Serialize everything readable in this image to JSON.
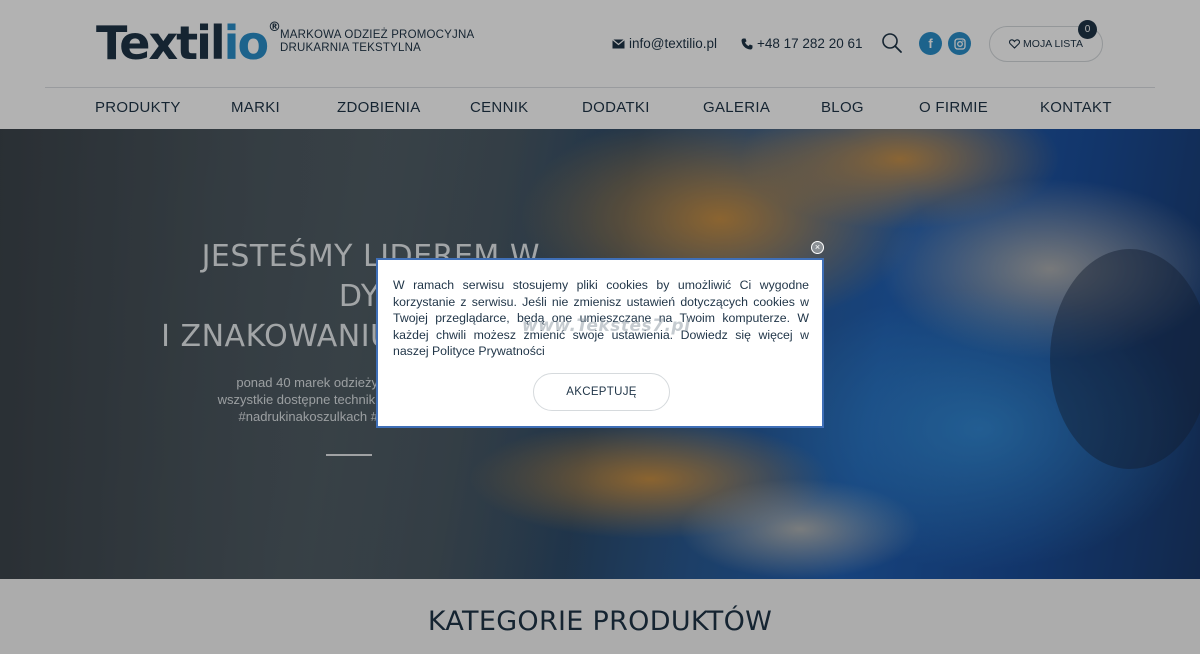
{
  "header": {
    "logo": {
      "text_main": "Textil",
      "text_accent": "io",
      "registered": "®"
    },
    "tagline": [
      "MARKOWA ODZIEŻ PROMOCYJNA",
      "DRUKARNIA TEKSTYLNA"
    ],
    "email": "info@textilio.pl",
    "phone": "+48 17 282 20 61",
    "social": {
      "facebook": "f"
    },
    "wishlist": {
      "label": "MOJA LISTA",
      "count": "0"
    }
  },
  "nav": {
    "items": [
      "PRODUKTY",
      "MARKI",
      "ZDOBIENIA",
      "CENNIK",
      "DODATKI",
      "GALERIA",
      "BLOG",
      "O FIRMIE",
      "KONTAKT"
    ]
  },
  "hero": {
    "title_lines": [
      "JESTEŚMY LIDEREM W",
      "DYSTRYBUCJI",
      "I ZNAKOWANIU ODZIEŻY"
    ],
    "subtitle_lines": [
      "ponad 40 marek odzieży",
      "wszystkie dostępne techniki",
      "#nadrukinakoszulkach #"
    ]
  },
  "cookie_dialog": {
    "text": "W ramach serwisu stosujemy pliki cookies by umożliwić Ci wygodne korzystanie z serwisu. Jeśli nie zmienisz ustawień dotyczących cookies w Twojej przeglądarce, będą one umieszczane na Twoim komputerze. W każdej chwili możesz zmienić swoje ustawienia. Dowiedz się więcej w naszej Polityce Prywatności",
    "accept_label": "AKCEPTUJĘ",
    "close_symbol": "×",
    "watermark": "www.Tekstes7.pl"
  },
  "section": {
    "title": "KATEGORIE PRODUKTÓW"
  },
  "colors": {
    "brand_dark": "#1f3447",
    "brand_accent": "#2a8ec9",
    "dialog_border": "#3f6fb7"
  }
}
